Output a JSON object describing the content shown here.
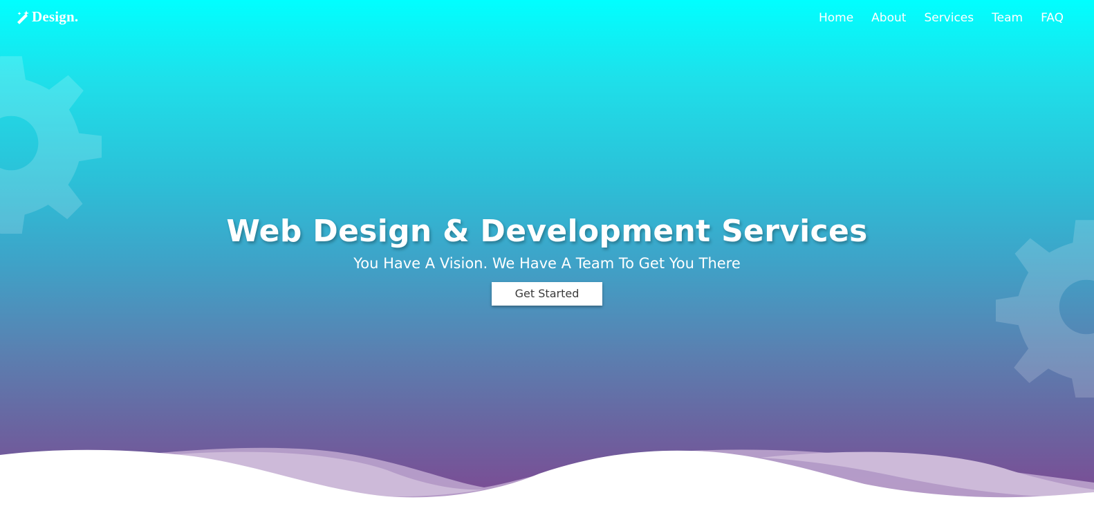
{
  "brand": {
    "logo_text": "Design.",
    "logo_icon": "magic-wand-icon"
  },
  "nav": {
    "items": [
      {
        "label": "Home"
      },
      {
        "label": "About"
      },
      {
        "label": "Services"
      },
      {
        "label": "Team"
      },
      {
        "label": "FAQ"
      }
    ]
  },
  "hero": {
    "title": "Web Design & Development Services",
    "subtitle": "You Have A Vision. We Have A Team To Get You There",
    "cta_label": "Get Started",
    "decorations": [
      "gear-icon",
      "gear-icon"
    ]
  },
  "colors": {
    "gradient_top": "#00ffff",
    "gradient_bottom": "#7c4a92",
    "wave_back": "#c9b6d6",
    "wave_front": "#ffffff",
    "text": "#ffffff"
  }
}
